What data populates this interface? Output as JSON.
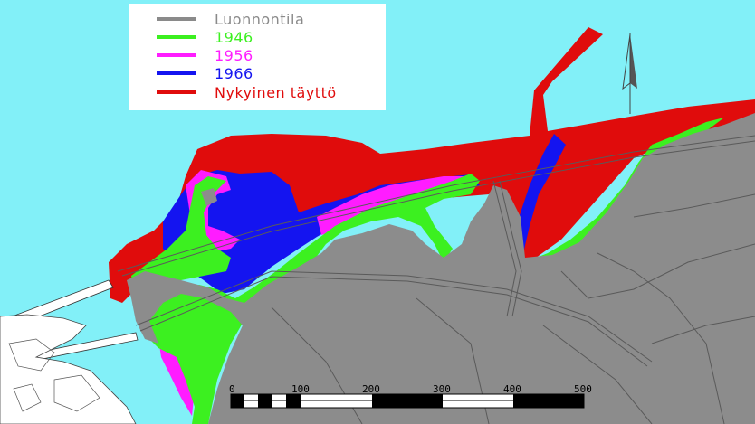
{
  "legend": {
    "items": [
      {
        "label": "Luonnontila",
        "color": "#8a8a8a"
      },
      {
        "label": "1946",
        "color": "#3cf020"
      },
      {
        "label": "1956",
        "color": "#ff1cff"
      },
      {
        "label": "1966",
        "color": "#1414f0"
      },
      {
        "label": "Nykyinen täyttö",
        "color": "#e00c0c"
      }
    ]
  },
  "scale": {
    "ticks": [
      "0",
      "100",
      "200",
      "300",
      "400",
      "500"
    ]
  },
  "colors": {
    "water": "#82f0f8",
    "land": "#8c8c8c",
    "fill_1946": "#3cf020",
    "fill_1956": "#ff1cff",
    "fill_1966": "#1414f0",
    "fill_current": "#e00c0c"
  },
  "icons": {
    "north": "north-arrow-icon"
  }
}
